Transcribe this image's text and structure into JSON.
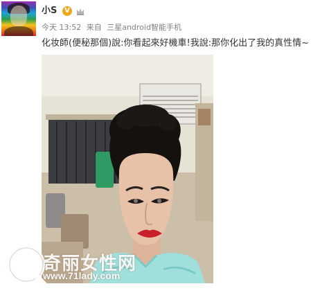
{
  "user": {
    "name": "小S",
    "verified_badge": "V",
    "avatar_icon": "avatar-portrait"
  },
  "meta": {
    "time": "今天 13:52",
    "source_prefix": "来自",
    "source": "三星android智能手机"
  },
  "post": {
    "text": "化妆師(便秘那個)說:你看起來好機車!我說:那你化出了我的真性情~"
  },
  "watermark": {
    "text": "奇丽女性网",
    "url": "www.71lady.com"
  },
  "colors": {
    "username": "#333333",
    "meta": "#808080",
    "verified": "#f0a91c",
    "towel": "#9fe0dc",
    "lips": "#c8202a"
  }
}
